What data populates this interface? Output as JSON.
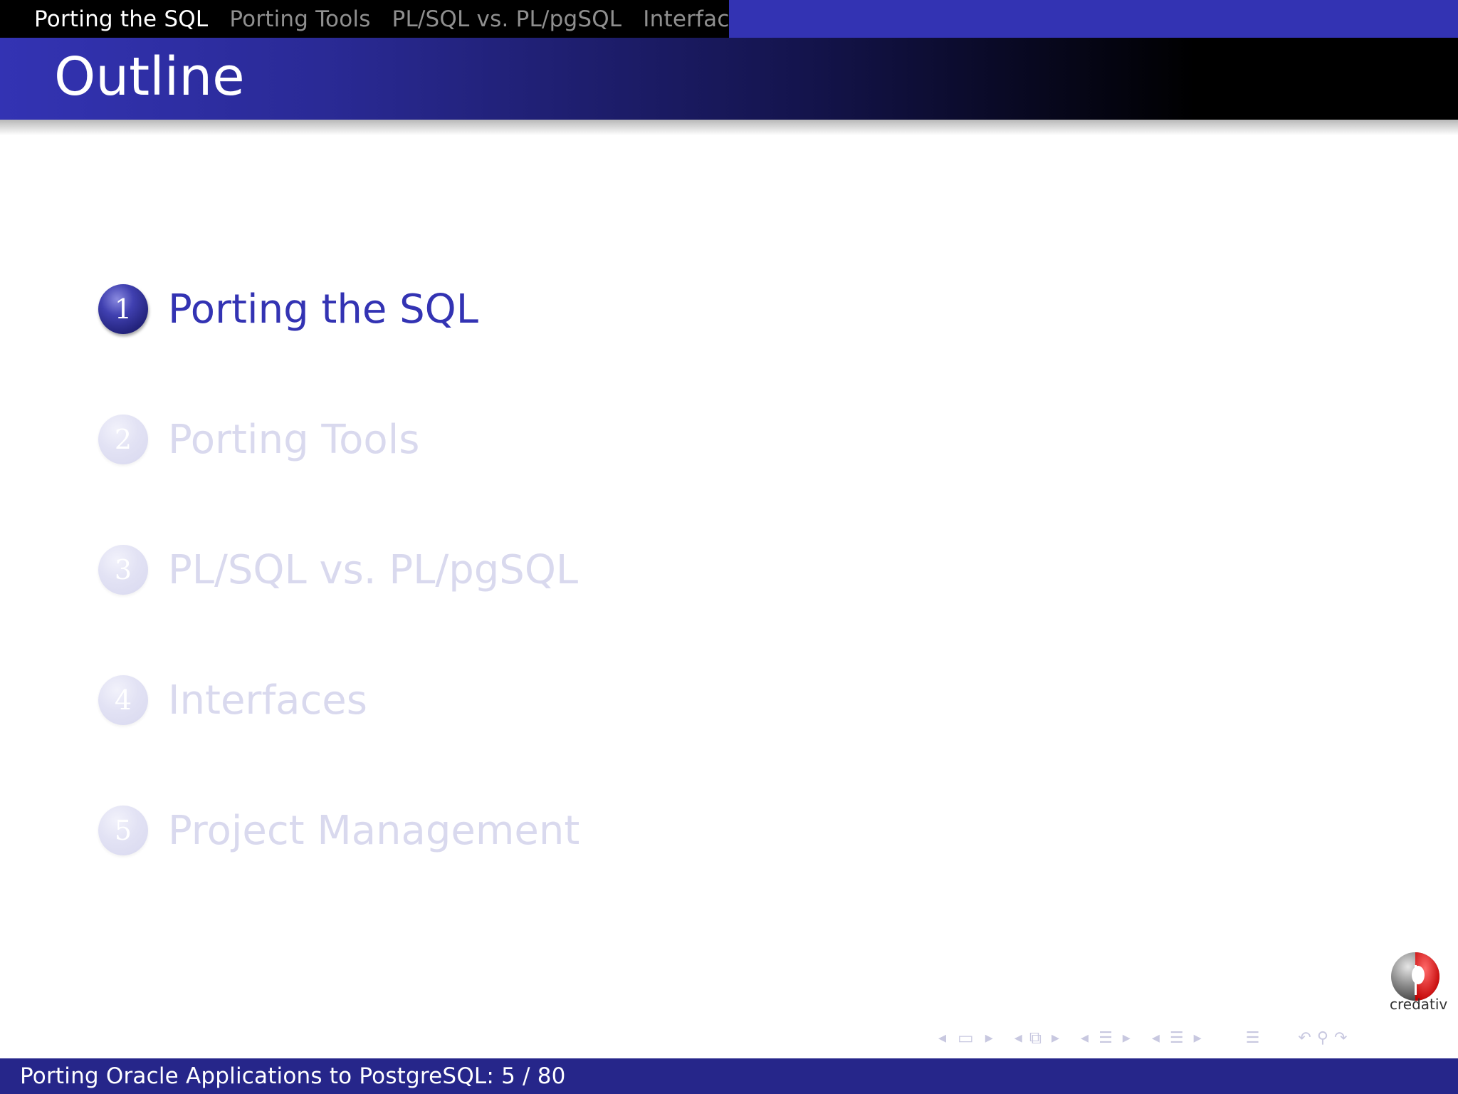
{
  "nav": {
    "items": [
      {
        "label": "Porting the SQL",
        "active": true
      },
      {
        "label": "Porting Tools",
        "active": false
      },
      {
        "label": "PL/SQL vs. PL/pgSQL",
        "active": false
      },
      {
        "label": "Interfaces",
        "active": false
      }
    ]
  },
  "title": "Outline",
  "outline": {
    "items": [
      {
        "number": "1",
        "label": "Porting the SQL",
        "current": true
      },
      {
        "number": "2",
        "label": "Porting Tools",
        "current": false
      },
      {
        "number": "3",
        "label": "PL/SQL vs. PL/pgSQL",
        "current": false
      },
      {
        "number": "4",
        "label": "Interfaces",
        "current": false
      },
      {
        "number": "5",
        "label": "Project Management",
        "current": false
      }
    ]
  },
  "logo": {
    "text": "credativ"
  },
  "footer": {
    "text": "Porting Oracle Applications to PostgreSQL: 5 / 80"
  },
  "colors": {
    "primary": "#3333b3",
    "footer": "#26268a",
    "dim_text": "#d9d9ee"
  }
}
